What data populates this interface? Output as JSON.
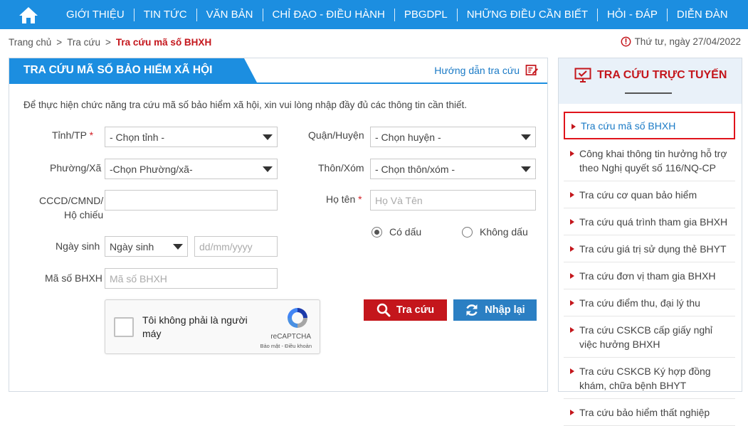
{
  "nav": {
    "items": [
      {
        "label": "GIỚI THIỆU"
      },
      {
        "label": "TIN TỨC"
      },
      {
        "label": "VĂN BẢN"
      },
      {
        "label": "CHỈ ĐẠO - ĐIỀU HÀNH"
      },
      {
        "label": "PBGDPL"
      },
      {
        "label": "NHỮNG ĐIỀU CẦN BIẾT"
      },
      {
        "label": "HỎI - ĐÁP"
      },
      {
        "label": "DIỄN ĐÀN"
      }
    ]
  },
  "breadcrumb": {
    "home": "Trang chủ",
    "section": "Tra cứu",
    "current": "Tra cứu mã số BHXH",
    "separator": ">"
  },
  "date": "Thứ tư, ngày 27/04/2022",
  "panel": {
    "title": "TRA CỨU MÃ SỐ BẢO HIỂM XÃ HỘI",
    "guide_link": "Hướng dẫn tra cứu",
    "intro": "Để thực hiện chức năng tra cứu mã số bảo hiểm xã hội, xin vui lòng nhập đầy đủ các thông tin cần thiết."
  },
  "form": {
    "province_label": "Tỉnh/TP",
    "province_value": "- Chọn tỉnh -",
    "district_label": "Quận/Huyện",
    "district_value": "- Chọn huyện -",
    "ward_label": "Phường/Xã",
    "ward_value": "-Chọn Phường/xã-",
    "hamlet_label": "Thôn/Xóm",
    "hamlet_value": "- Chọn thôn/xóm -",
    "id_label_line1": "CCCD/CMND/",
    "id_label_line2": "Hộ chiếu",
    "id_value": "",
    "name_label": "Họ tên",
    "name_placeholder": "Họ Và Tên",
    "required_mark": "*",
    "accent_label": "Có dấu",
    "no_accent_label": "Không dấu",
    "accent_selected": true,
    "dob_label": "Ngày sinh",
    "dob_type_value": "Ngày sinh",
    "dob_placeholder": "dd/mm/yyyy",
    "code_label": "Mã số BHXH",
    "code_placeholder": "Mã số BHXH"
  },
  "captcha": {
    "text": "Tôi không phải là người máy",
    "brand": "reCAPTCHA",
    "terms": "Bảo mật - Điều khoản"
  },
  "buttons": {
    "search": "Tra cứu",
    "reset": "Nhập lại"
  },
  "sidebar": {
    "title": "TRA CỨU TRỰC TUYẾN",
    "items": [
      {
        "label": "Tra cứu mã số BHXH",
        "active": true
      },
      {
        "label": "Công khai thông tin hưởng hỗ trợ theo Nghị quyết số 116/NQ-CP",
        "active": false
      },
      {
        "label": "Tra cứu cơ quan bảo hiểm",
        "active": false
      },
      {
        "label": "Tra cứu quá trình tham gia BHXH",
        "active": false
      },
      {
        "label": "Tra cứu giá trị sử dụng thẻ BHYT",
        "active": false
      },
      {
        "label": "Tra cứu đơn vị tham gia BHXH",
        "active": false
      },
      {
        "label": "Tra cứu điểm thu, đại lý thu",
        "active": false
      },
      {
        "label": "Tra cứu CSKCB cấp giấy nghỉ việc hưởng BHXH",
        "active": false
      },
      {
        "label": "Tra cứu CSKCB Ký hợp đồng khám, chữa bệnh BHYT",
        "active": false
      },
      {
        "label": "Tra cứu bảo hiểm thất nghiệp",
        "active": false
      }
    ]
  },
  "colors": {
    "primary": "#1c8ee0",
    "accent_red": "#c4161c",
    "reset_blue": "#2b7fc3"
  },
  "icons": {
    "home": "home-icon",
    "clock": "clock-icon",
    "guide": "edit-note-icon",
    "sidebar": "monitor-check-icon",
    "search": "search-icon",
    "reset": "refresh-icon"
  }
}
